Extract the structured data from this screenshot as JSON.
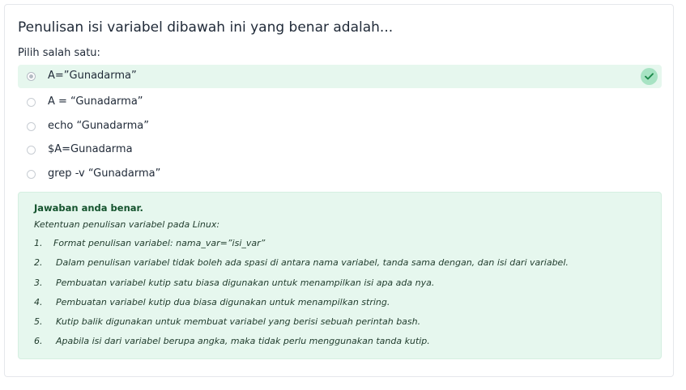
{
  "question": {
    "text": "Penulisan isi variabel dibawah ini yang benar adalah...",
    "prompt": "Pilih salah satu:"
  },
  "options": [
    {
      "label": "A=”Gunadarma”",
      "selected": true,
      "correct": true
    },
    {
      "label": "A = “Gunadarma”",
      "selected": false,
      "correct": false
    },
    {
      "label": "echo “Gunadarma”",
      "selected": false,
      "correct": false
    },
    {
      "label": "$A=Gunadarma",
      "selected": false,
      "correct": false
    },
    {
      "label": "grep -v “Gunadarma”",
      "selected": false,
      "correct": false
    }
  ],
  "feedback": {
    "title": "Jawaban anda benar.",
    "intro": "Ketentuan penulisan variabel pada Linux:",
    "items": [
      {
        "num": "1.",
        "text": "Format penulisan variabel: nama_var=”isi_var”"
      },
      {
        "num": "2.",
        "text": "Dalam penulisan variabel tidak boleh ada spasi di antara nama variabel, tanda sama dengan, dan isi dari variabel."
      },
      {
        "num": "3.",
        "text": "Pembuatan variabel kutip satu biasa digunakan untuk menampilkan isi apa ada nya."
      },
      {
        "num": "4.",
        "text": "Pembuatan variabel kutip dua biasa digunakan untuk menampilkan string."
      },
      {
        "num": "5.",
        "text": "Kutip balik digunakan untuk membuat variabel yang berisi sebuah perintah bash."
      },
      {
        "num": "6.",
        "text": "Apabila isi dari variabel berupa angka, maka tidak perlu menggunakan tanda kutip."
      }
    ]
  },
  "colors": {
    "correct_bg": "#e6f7ee",
    "check_badge": "#a7e3c3",
    "check_mark": "#1e8a4c"
  },
  "icons": {
    "correct": "check-icon"
  }
}
